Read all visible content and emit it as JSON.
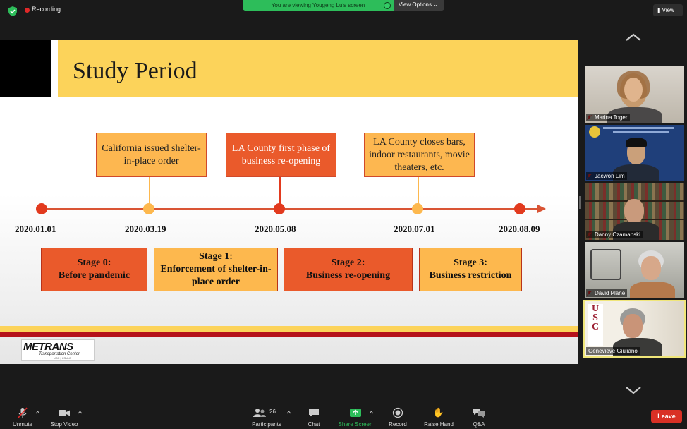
{
  "top_bar": {
    "recording_label": "Recording",
    "viewing_banner": "You are viewing Yougeng Lu's screen",
    "view_options_label": "View Options",
    "view_button_label": "View"
  },
  "slide": {
    "title": "Study Period",
    "events": [
      {
        "text": "California issued shelter-in-place order"
      },
      {
        "text": "LA County first phase of business re-opening"
      },
      {
        "text": "LA County closes bars, indoor restaurants, movie theaters, etc."
      }
    ],
    "dates": [
      "2020.01.01",
      "2020.03.19",
      "2020.05.08",
      "2020.07.01",
      "2020.08.09"
    ],
    "stages": [
      {
        "title": "Stage 0:",
        "desc": "Before pandemic"
      },
      {
        "title": "Stage 1:",
        "desc": "Enforcement of shelter-in-place order"
      },
      {
        "title": "Stage 2:",
        "desc": "Business re-opening"
      },
      {
        "title": "Stage 3:",
        "desc": "Business restriction"
      }
    ],
    "logo_main": "METRANS",
    "logo_sub": "Transportation Center",
    "logo_sub2": "USC | CSULB"
  },
  "participants": [
    {
      "name": "Marina Toger",
      "muted": true
    },
    {
      "name": "Jaewon Lim",
      "muted": true
    },
    {
      "name": "Danny Czamanski",
      "muted": true
    },
    {
      "name": "David Plane",
      "muted": true
    },
    {
      "name": "Genevieve Giuliano",
      "muted": false,
      "active_speaker": true
    }
  ],
  "toolbar": {
    "unmute": "Unmute",
    "stop_video": "Stop Video",
    "participants": "Participants",
    "participant_count": "26",
    "chat": "Chat",
    "share_screen": "Share Screen",
    "record": "Record",
    "raise_hand": "Raise Hand",
    "qa": "Q&A",
    "leave": "Leave"
  },
  "colors": {
    "share_green": "#2dbd5a",
    "leave_red": "#d93025",
    "active_speaker_border": "#f0e67a",
    "slide_yellow": "#fcd35a",
    "slide_orange": "#ea5a2b"
  }
}
